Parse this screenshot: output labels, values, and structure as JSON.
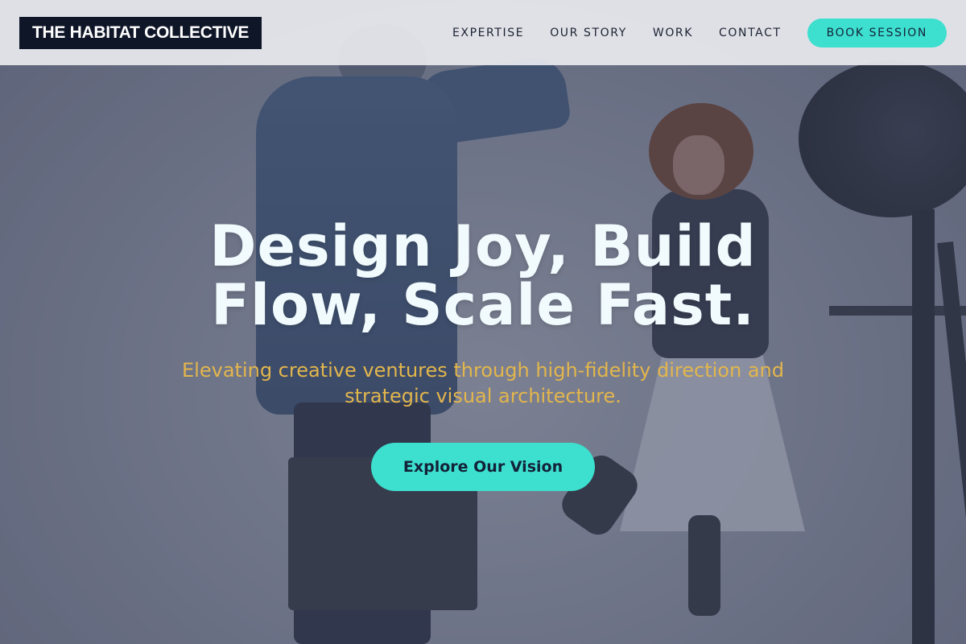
{
  "brand": {
    "name": "THE HABITAT COLLECTIVE"
  },
  "nav": {
    "items": [
      {
        "label": "EXPERTISE"
      },
      {
        "label": "OUR STORY"
      },
      {
        "label": "WORK"
      },
      {
        "label": "CONTACT"
      }
    ],
    "book_label": "BOOK SESSION"
  },
  "hero": {
    "title_line1": "Design Joy, Build",
    "title_line2": "Flow, Scale Fast.",
    "subtitle": "Elevating creative ventures through high-fidelity direction and strategic visual architecture.",
    "cta_label": "Explore Our Vision"
  },
  "colors": {
    "accent": "#3ddfcf",
    "subtitle": "#e3b64c",
    "logo_bg": "#0f1628",
    "header_bg": "#e8eaee"
  }
}
